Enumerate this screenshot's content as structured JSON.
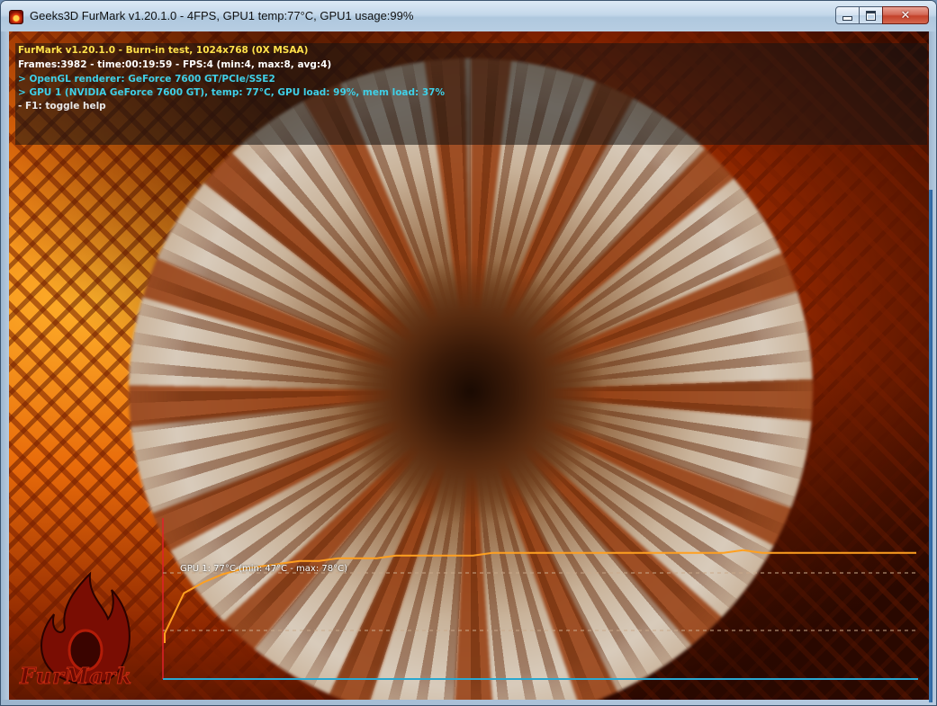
{
  "window": {
    "title": "Geeks3D FurMark v1.20.1.0 - 4FPS, GPU1 temp:77°C, GPU1 usage:99%",
    "controls": {
      "minimize": "minimize",
      "maximize": "maximize",
      "close": "✕"
    }
  },
  "hud": {
    "lines": [
      {
        "text": "FurMark v1.20.1.0 - Burn-in test, 1024x768 (0X MSAA)",
        "color": "#ffe14a"
      },
      {
        "text": "Frames:3982 - time:00:19:59 - FPS:4 (min:4, max:8, avg:4)",
        "color": "#ffffff"
      },
      {
        "text": "> OpenGL renderer: GeForce 7600 GT/PCIe/SSE2",
        "color": "#3fd0e8"
      },
      {
        "text": "> GPU 1 (NVIDIA GeForce 7600 GT), temp: 77°C, GPU load: 99%, mem load: 37%",
        "color": "#3fd0e8"
      },
      {
        "text": "- F1: toggle help",
        "color": "#e8e8e8"
      }
    ]
  },
  "temp_graph": {
    "label": "GPU 1: 77°C (min: 47°C - max: 78°C)",
    "current": 77,
    "min": 47,
    "max": 78,
    "line_color": "#ffa020",
    "axis_color": "#2aa8d0"
  },
  "logo": {
    "text": "FurMark"
  },
  "chart_data": {
    "type": "line",
    "title": "GPU 1: 77°C (min: 47°C - max: 78°C)",
    "xlabel": "",
    "ylabel": "",
    "series": [
      {
        "name": "GPU 1",
        "values": [
          47,
          62,
          66,
          69,
          71,
          72,
          73,
          74,
          74,
          75,
          75,
          75,
          76,
          76,
          76,
          76,
          76,
          77,
          77,
          77,
          77,
          77,
          77,
          77,
          77,
          77,
          77,
          77,
          77,
          77,
          78,
          77,
          77,
          77,
          77,
          77,
          77,
          77,
          77,
          77
        ]
      }
    ],
    "ylim": [
      30,
      90
    ],
    "grid": false
  }
}
